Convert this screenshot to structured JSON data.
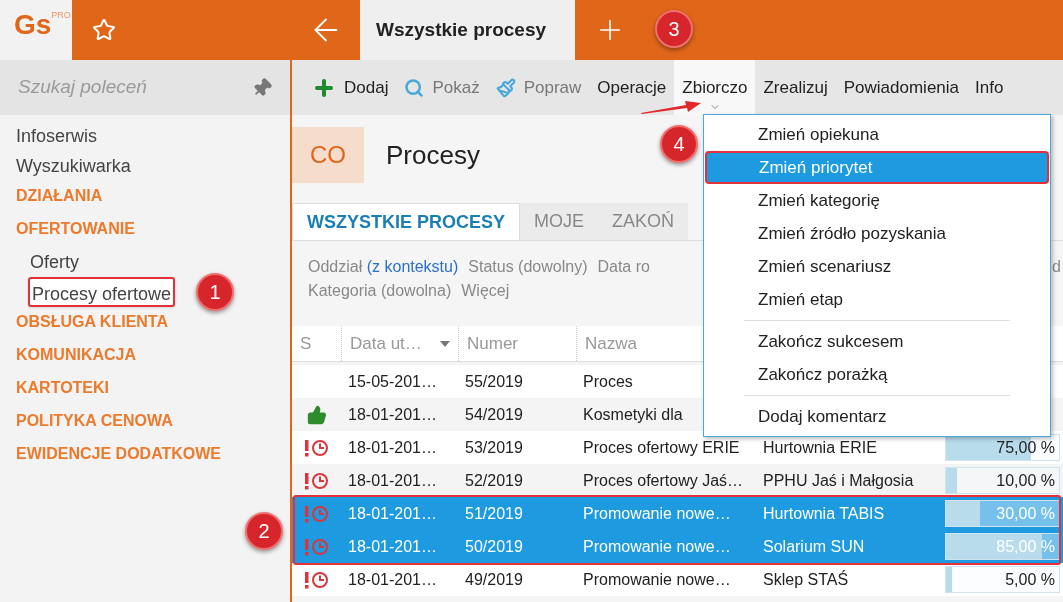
{
  "logo": {
    "text": "Gs",
    "badge": "PRO"
  },
  "tab": {
    "title": "Wszystkie procesy",
    "selected": true
  },
  "sidebar": {
    "search": {
      "placeholder": "Szukaj poleceń"
    },
    "items": [
      {
        "label": "Infoserwis",
        "kind": "link",
        "selected": false
      },
      {
        "label": "Wyszukiwarka",
        "kind": "link",
        "selected": false
      },
      {
        "label": "DZIAŁANIA",
        "kind": "section",
        "selected": false
      },
      {
        "label": "OFERTOWANIE",
        "kind": "section",
        "selected": false,
        "children": [
          {
            "label": "Oferty",
            "kind": "link",
            "selected": false
          },
          {
            "label": "Procesy ofertowe",
            "kind": "link",
            "selected": true
          }
        ]
      },
      {
        "label": "OBSŁUGA KLIENTA",
        "kind": "section",
        "selected": false
      },
      {
        "label": "KOMUNIKACJA",
        "kind": "section",
        "selected": false
      },
      {
        "label": "KARTOTEKI",
        "kind": "section",
        "selected": false
      },
      {
        "label": "POLITYKA CENOWA",
        "kind": "section",
        "selected": false
      },
      {
        "label": "EWIDENCJE DODATKOWE",
        "kind": "section",
        "selected": false
      }
    ]
  },
  "toolbar": [
    {
      "label": "Dodaj",
      "kind": "plus",
      "disabled": false,
      "selected": false
    },
    {
      "label": "Pokaż",
      "kind": "search",
      "disabled": true,
      "selected": false
    },
    {
      "label": "Popraw",
      "kind": "brush",
      "disabled": true,
      "selected": false
    },
    {
      "label": "Operacje",
      "disabled": false,
      "selected": false
    },
    {
      "label": "Zbiorczo",
      "disabled": false,
      "selected": true
    },
    {
      "label": "Zrealizuj",
      "disabled": false,
      "selected": false
    },
    {
      "label": "Powiadomienia",
      "disabled": false,
      "selected": false
    },
    {
      "label": "Info",
      "disabled": false,
      "selected": false
    }
  ],
  "header": {
    "badge": "CO",
    "title": "Procesy"
  },
  "tabs": [
    {
      "label": "WSZYSTKIE PROCESY",
      "selected": true
    },
    {
      "label": "MOJE",
      "selected": false
    },
    {
      "label": "ZAKOŃ",
      "selected": false
    }
  ],
  "filters": [
    [
      {
        "label": "Oddział",
        "value": "(z kontekstu)",
        "link": true
      },
      {
        "label": "Status",
        "value": "(dowolny)",
        "link": false
      },
      {
        "label": "Data ro"
      },
      {
        "label": "d"
      }
    ],
    [
      {
        "label": "Kategoria",
        "value": "(dowolna)",
        "link": false
      },
      {
        "label": "Więcej"
      }
    ]
  ],
  "table": {
    "columns": [
      "S",
      "Data ut…",
      "Numer",
      "Nazwa"
    ],
    "rows": [
      {
        "kind": "none",
        "date": "15-05-201…",
        "number": "55/2019",
        "name": "Proces",
        "selected": false
      },
      {
        "kind": "thumb",
        "date": "18-01-201…",
        "number": "54/2019",
        "name": "Kosmetyki dla",
        "selected": false
      },
      {
        "kind": "alarm",
        "date": "18-01-201…",
        "number": "53/2019",
        "name": "Proces ofertowy ERIE",
        "client": "Hurtownia ERIE",
        "level": 0.75,
        "percent": "75,00 %",
        "selected": false
      },
      {
        "kind": "alarm",
        "date": "18-01-201…",
        "number": "52/2019",
        "name": "Proces ofertowy Jaś…",
        "client": "PPHU Jaś i Małgosia",
        "level": 0.1,
        "percent": "10,00 %",
        "selected": false
      },
      {
        "kind": "alarm",
        "date": "18-01-201…",
        "number": "51/2019",
        "name": "Promowanie nowe…",
        "client": "Hurtownia TABIS",
        "level": 0.3,
        "percent": "30,00 %",
        "selected": true
      },
      {
        "kind": "alarm",
        "date": "18-01-201…",
        "number": "50/2019",
        "name": "Promowanie nowe…",
        "client": "Solarium SUN",
        "level": 0.85,
        "percent": "85,00 %",
        "selected": true
      },
      {
        "kind": "alarm",
        "date": "18-01-201…",
        "number": "49/2019",
        "name": "Promowanie nowe…",
        "client": "Sklep STAŚ",
        "level": 0.05,
        "percent": "5,00 %",
        "selected": false
      }
    ]
  },
  "menu": {
    "groups": [
      [
        {
          "label": "Zmień opiekuna",
          "selected": false
        },
        {
          "label": "Zmień priorytet",
          "selected": true
        },
        {
          "label": "Zmień kategorię",
          "selected": false
        },
        {
          "label": "Zmień źródło pozyskania",
          "selected": false
        },
        {
          "label": "Zmień scenariusz",
          "selected": false
        },
        {
          "label": "Zmień etap",
          "selected": false
        }
      ],
      [
        {
          "label": "Zakończ sukcesem",
          "selected": false
        },
        {
          "label": "Zakończ porażką",
          "selected": false
        }
      ],
      [
        {
          "label": "Dodaj komentarz",
          "selected": false
        }
      ]
    ]
  },
  "annotations": [
    "1",
    "2",
    "3",
    "4"
  ]
}
